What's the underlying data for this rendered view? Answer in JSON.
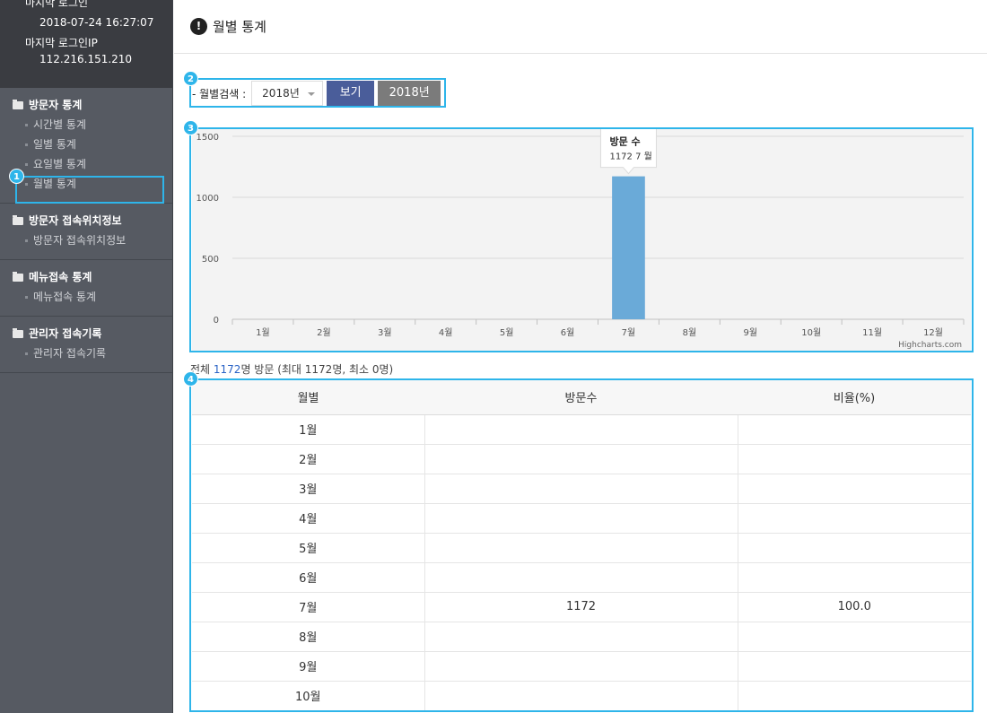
{
  "login": {
    "last_login_label": "마지막 로그인",
    "last_login_value": "2018-07-24 16:27:07",
    "last_ip_label": "마지막 로그인IP",
    "last_ip_value": "112.216.151.210"
  },
  "sidebar": {
    "groups": [
      {
        "title": "방문자 통계",
        "items": [
          "시간별 통계",
          "일별 통계",
          "요일별 통계",
          "월별 통계"
        ]
      },
      {
        "title": "방문자 접속위치정보",
        "items": [
          "방문자 접속위치정보"
        ]
      },
      {
        "title": "메뉴접속 통계",
        "items": [
          "메뉴접속 통계"
        ]
      },
      {
        "title": "관리자 접속기록",
        "items": [
          "관리자 접속기록"
        ]
      }
    ]
  },
  "header": {
    "title": "월별 통계",
    "icon": "exclamation-icon"
  },
  "search": {
    "label": "- 월별검색 :",
    "selected_year": "2018년",
    "view_button": "보기",
    "year_button": "2018년"
  },
  "callouts": [
    "1",
    "2",
    "3",
    "4"
  ],
  "chart_data": {
    "type": "bar",
    "categories": [
      "1월",
      "2월",
      "3월",
      "4월",
      "5월",
      "6월",
      "7월",
      "8월",
      "9월",
      "10월",
      "11월",
      "12월"
    ],
    "series": [
      {
        "name": "방문 수",
        "values": [
          0,
          0,
          0,
          0,
          0,
          0,
          1172,
          0,
          0,
          0,
          0,
          0
        ],
        "color": "#6aaad8"
      }
    ],
    "ylim": [
      0,
      1500
    ],
    "yticks": [
      "0",
      "500",
      "1000",
      "1500"
    ],
    "grid": true,
    "tooltip": {
      "title": "방문 수",
      "text": "1172 7 월"
    },
    "credit": "Highcharts.com"
  },
  "summary": {
    "prefix": "전체 ",
    "total": "1172",
    "suffix": "명 방문 (최대 1172명, 최소 0명)"
  },
  "table": {
    "headers": [
      "월별",
      "방문수",
      "비율(%)"
    ],
    "rows": [
      [
        "1월",
        "",
        ""
      ],
      [
        "2월",
        "",
        ""
      ],
      [
        "3월",
        "",
        ""
      ],
      [
        "4월",
        "",
        ""
      ],
      [
        "5월",
        "",
        ""
      ],
      [
        "6월",
        "",
        ""
      ],
      [
        "7월",
        "1172",
        "100.0"
      ],
      [
        "8월",
        "",
        ""
      ],
      [
        "9월",
        "",
        ""
      ],
      [
        "10월",
        "",
        ""
      ]
    ]
  }
}
